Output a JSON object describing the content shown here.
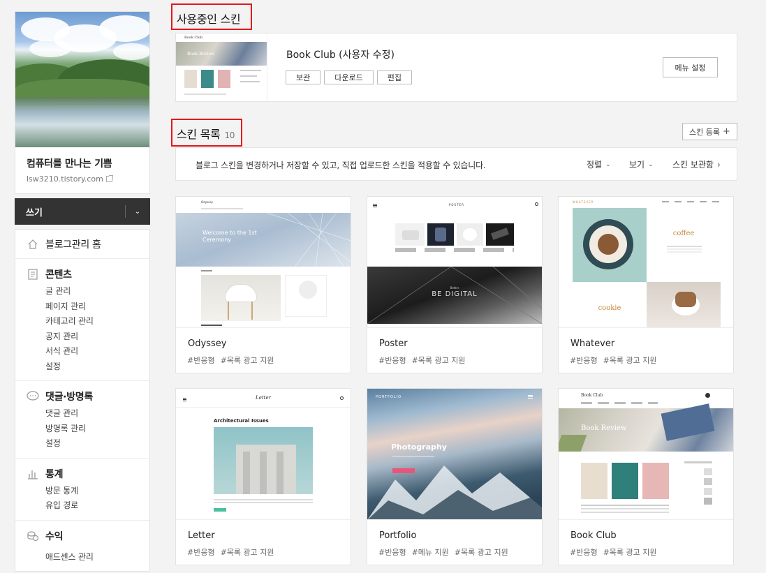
{
  "profile": {
    "blog_name": "컴퓨터를 만나는 기쁨",
    "blog_url": "lsw3210.tistory.com"
  },
  "write": {
    "label": "쓰기"
  },
  "menu": {
    "home": "블로그관리 홈",
    "contents": {
      "title": "콘텐츠",
      "items": [
        "글 관리",
        "페이지 관리",
        "카테고리 관리",
        "공지 관리",
        "서식 관리",
        "설정"
      ]
    },
    "comments": {
      "title": "댓글·방명록",
      "items": [
        "댓글 관리",
        "방명록 관리",
        "설정"
      ]
    },
    "stats": {
      "title": "통계",
      "items": [
        "방문 통계",
        "유입 경로"
      ]
    },
    "revenue": {
      "title": "수익",
      "items": [
        "애드센스 관리"
      ]
    }
  },
  "current_skin": {
    "section_title": "사용중인 스킨",
    "name": "Book Club (사용자 수정)",
    "buttons": [
      "보관",
      "다운로드",
      "편집"
    ],
    "menu_setting": "메뉴 설정",
    "thumb_caption": "Book Review",
    "thumb_brand": "Book Club"
  },
  "skin_list": {
    "section_title": "스킨 목록",
    "count": "10",
    "register_label": "스킨 등록",
    "info": "블로그 스킨을 변경하거나 저장할 수 있고, 직접 업로드한 스킨을 적용할 수 있습니다.",
    "sort_label": "정렬",
    "view_label": "보기",
    "storage_label": "스킨 보관함"
  },
  "skins": [
    {
      "name": "Odyssey",
      "tags": [
        "#반응형",
        "#목록 광고 지원"
      ],
      "thumb_text": "Welcome to the 1st Ceremony"
    },
    {
      "name": "Poster",
      "tags": [
        "#반응형",
        "#목록 광고 지원"
      ],
      "thumb_text": "BE DIGITAL"
    },
    {
      "name": "Whatever",
      "tags": [
        "#반응형",
        "#목록 광고 지원"
      ],
      "thumb_text": "coffee",
      "thumb_text2": "cookie"
    },
    {
      "name": "Letter",
      "tags": [
        "#반응형",
        "#목록 광고 지원"
      ],
      "thumb_text": "Architectural Issues"
    },
    {
      "name": "Portfolio",
      "tags": [
        "#반응형",
        "#메뉴 지원",
        "#목록 광고 지원"
      ],
      "thumb_text": "Photography"
    },
    {
      "name": "Book Club",
      "tags": [
        "#반응형",
        "#목록 광고 지원"
      ],
      "thumb_text": "Book Review"
    }
  ]
}
